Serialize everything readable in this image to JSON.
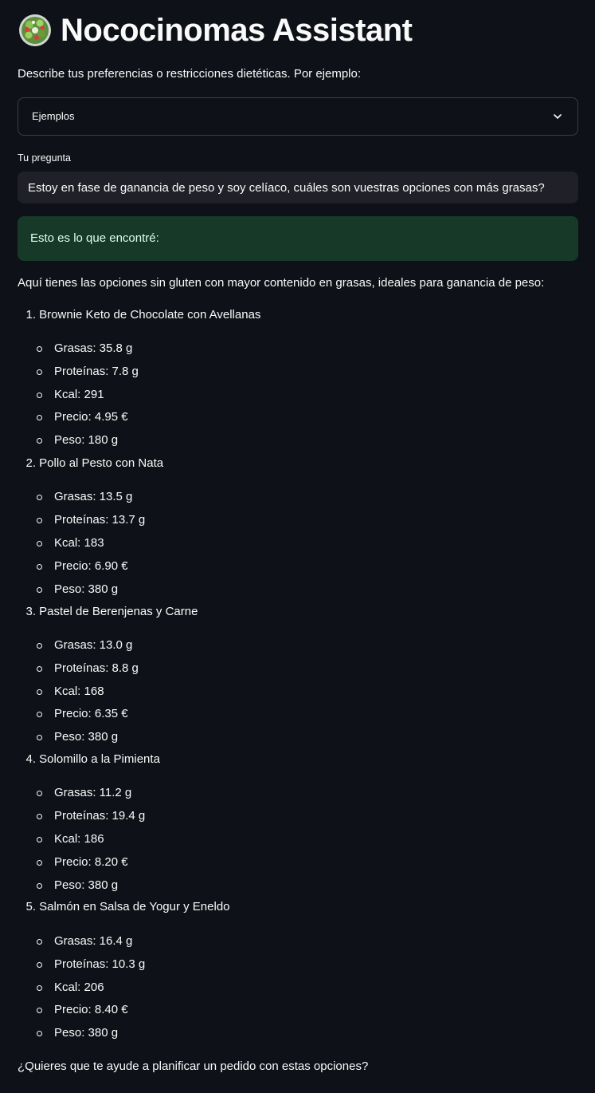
{
  "header": {
    "title": "Nococinomas Assistant",
    "icon": "salad-bowl-icon"
  },
  "intro_text": "Describe tus preferencias o restricciones dietéticas. Por ejemplo:",
  "examples_select": {
    "value": "Ejemplos",
    "icon": "chevron-down-icon"
  },
  "question": {
    "label": "Tu pregunta",
    "value": "Estoy en fase de ganancia de peso y soy celíaco, cuáles son vuestras opciones con más grasas?"
  },
  "success_message": "Esto es lo que encontré:",
  "answer": {
    "intro": "Aquí tienes las opciones sin gluten con mayor contenido en grasas, ideales para ganancia de peso:",
    "options": [
      {
        "number": "1.",
        "name": "Brownie Keto de Chocolate con Avellanas",
        "details": [
          "Grasas: 35.8 g",
          "Proteínas: 7.8 g",
          "Kcal: 291",
          "Precio: 4.95 €",
          "Peso: 180 g"
        ]
      },
      {
        "number": "2.",
        "name": "Pollo al Pesto con Nata",
        "details": [
          "Grasas: 13.5 g",
          "Proteínas: 13.7 g",
          "Kcal: 183",
          "Precio: 6.90 €",
          "Peso: 380 g"
        ]
      },
      {
        "number": "3.",
        "name": "Pastel de Berenjenas y Carne",
        "details": [
          "Grasas: 13.0 g",
          "Proteínas: 8.8 g",
          "Kcal: 168",
          "Precio: 6.35 €",
          "Peso: 380 g"
        ]
      },
      {
        "number": "4.",
        "name": "Solomillo a la Pimienta",
        "details": [
          "Grasas: 11.2 g",
          "Proteínas: 19.4 g",
          "Kcal: 186",
          "Precio: 8.20 €",
          "Peso: 380 g"
        ]
      },
      {
        "number": "5.",
        "name": "Salmón en Salsa de Yogur y Eneldo",
        "details": [
          "Grasas: 16.4 g",
          "Proteínas: 10.3 g",
          "Kcal: 206",
          "Precio: 8.40 €",
          "Peso: 380 g"
        ]
      }
    ],
    "closing": "¿Quieres que te ayude a planificar un pedido con estas opciones?"
  },
  "colors": {
    "background": "#0e1117",
    "input_background": "#1f2028",
    "success_background": "#173928",
    "success_text": "#dffde9",
    "text": "#fafafa"
  }
}
